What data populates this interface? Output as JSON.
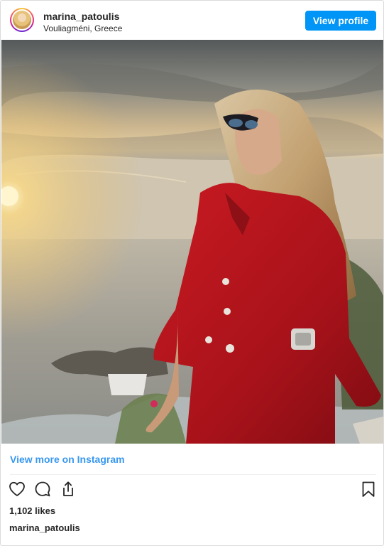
{
  "header": {
    "username": "marina_patoulis",
    "location": "Vouliagméni, Greece",
    "view_profile_label": "View profile"
  },
  "photo": {
    "subject": "woman-in-red-dress-at-sunset"
  },
  "footer": {
    "view_more_label": "View more on Instagram",
    "likes": "1,102 likes",
    "caption_username": "marina_patoulis"
  },
  "icons": {
    "like": "heart-icon",
    "comment": "comment-icon",
    "share": "share-icon",
    "save": "bookmark-icon"
  },
  "colors": {
    "accent": "#0095f6",
    "link": "#3897f0",
    "text": "#262626",
    "border": "#dbdbdb"
  }
}
